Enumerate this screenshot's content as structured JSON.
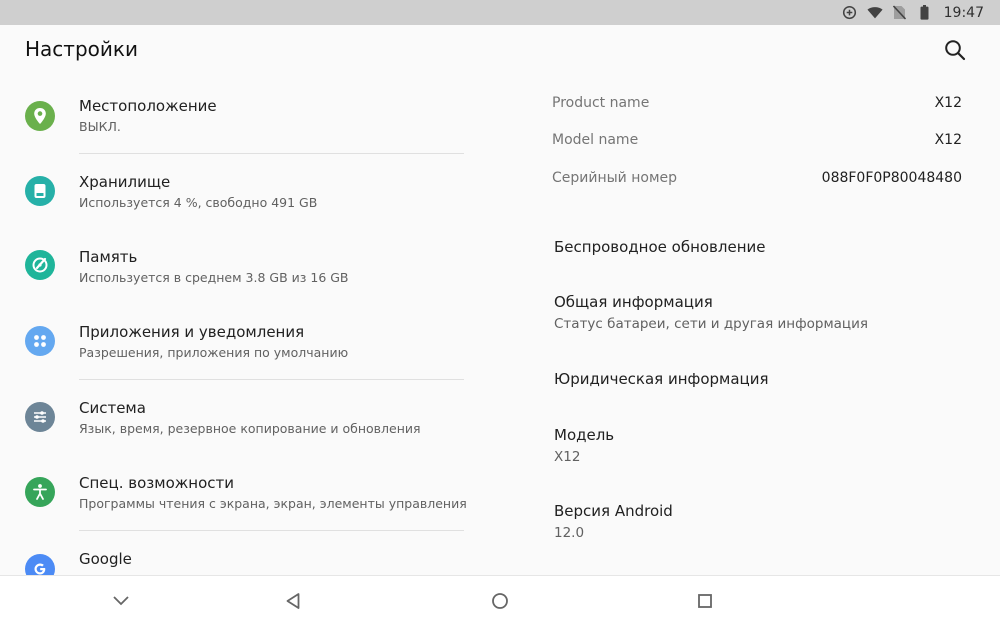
{
  "status_bar": {
    "time": "19:47",
    "icons": [
      "data-saver-icon",
      "wifi-icon",
      "no-sim-icon",
      "battery-icon"
    ]
  },
  "app_bar": {
    "title": "Настройки",
    "search_icon": "search-icon"
  },
  "menu": {
    "items": [
      {
        "title": "Местоположение",
        "subtitle": "ВЫКЛ.",
        "icon": "location-icon",
        "color": "#6ab04c"
      },
      {
        "title": "Хранилище",
        "subtitle": "Используется 4 %, свободно 491 GB",
        "icon": "storage-icon",
        "color": "#26b0a8"
      },
      {
        "title": "Память",
        "subtitle": "Используется в среднем 3.8 GB из 16 GB",
        "icon": "memory-icon",
        "color": "#1fb59a"
      },
      {
        "title": "Приложения и уведомления",
        "subtitle": "Разрешения, приложения по умолчанию",
        "icon": "apps-icon",
        "color": "#64a8f0"
      },
      {
        "title": "Система",
        "subtitle": "Язык, время, резервное копирование и обновления",
        "icon": "system-icon",
        "color": "#6d8597"
      },
      {
        "title": "Спец. возможности",
        "subtitle": "Программы чтения с экрана, экран, элементы управления",
        "icon": "accessibility-icon",
        "color": "#36a55a"
      },
      {
        "title": "Google",
        "subtitle": "",
        "icon": "google-icon",
        "color": "#4c8bf5"
      }
    ]
  },
  "device_info": {
    "rows": [
      {
        "label": "Product name",
        "value": "X12"
      },
      {
        "label": "Model name",
        "value": "X12"
      },
      {
        "label": "Серийный номер",
        "value": "088F0F0P80048480"
      }
    ]
  },
  "about": {
    "items": [
      {
        "title": "Беспроводное обновление",
        "subtitle": ""
      },
      {
        "title": "Общая информация",
        "subtitle": "Статус батареи, сети и другая информация"
      },
      {
        "title": "Юридическая информация",
        "subtitle": ""
      },
      {
        "title": "Модель",
        "subtitle": "X12"
      },
      {
        "title": "Версия Android",
        "subtitle": "12.0"
      }
    ]
  },
  "nav_bar": {
    "buttons": [
      "hide-keyboard-icon",
      "back-icon",
      "home-icon",
      "recents-icon"
    ]
  }
}
